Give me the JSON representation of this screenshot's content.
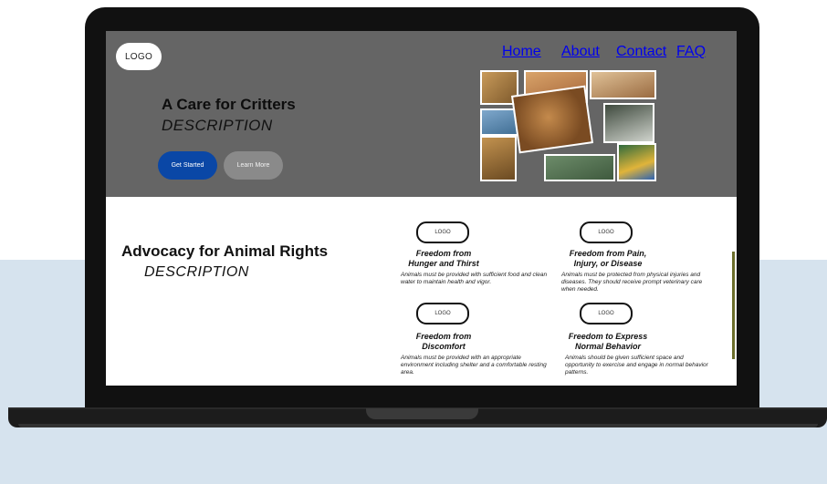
{
  "site": {
    "logo_text": "LOGO",
    "nav": [
      "Home",
      "About",
      "Contact",
      "FAQ"
    ]
  },
  "hero": {
    "title": "A Care for Critters",
    "description": "DESCRIPTION",
    "primary_button": "Get Started",
    "secondary_button": "Learn More"
  },
  "section": {
    "title": "Advocacy for Animal Rights",
    "description": "DESCRIPTION",
    "cards": [
      {
        "logo_text": "LOGO",
        "title": "Freedom from\nHunger and Thirst",
        "body": "Animals must be provided with sufficient food and clean water to maintain health and vigor."
      },
      {
        "logo_text": "LOGO",
        "title": "Freedom from Pain,\nInjury, or Disease",
        "body": "Animals must be protected from physical injuries and diseases. They should receive prompt veterinary care when needed."
      },
      {
        "logo_text": "LOGO",
        "title": "Freedom from\nDiscomfort",
        "body": "Animals must be provided with an appropriate environment including shelter and a comfortable resting area."
      },
      {
        "logo_text": "LOGO",
        "title": "Freedom to Express\nNormal Behavior",
        "body": "Animals should be given sufficient space and opportunity to exercise and engage in normal behavior patterns."
      }
    ]
  },
  "colors": {
    "hero_background": "#656565",
    "primary_button": "#0a47a6",
    "secondary_button": "#8a8a8a",
    "backdrop": "#d6e3ee",
    "laptop_frame": "#111111"
  },
  "collage_icons": [
    "animal-photo-collage-image"
  ]
}
